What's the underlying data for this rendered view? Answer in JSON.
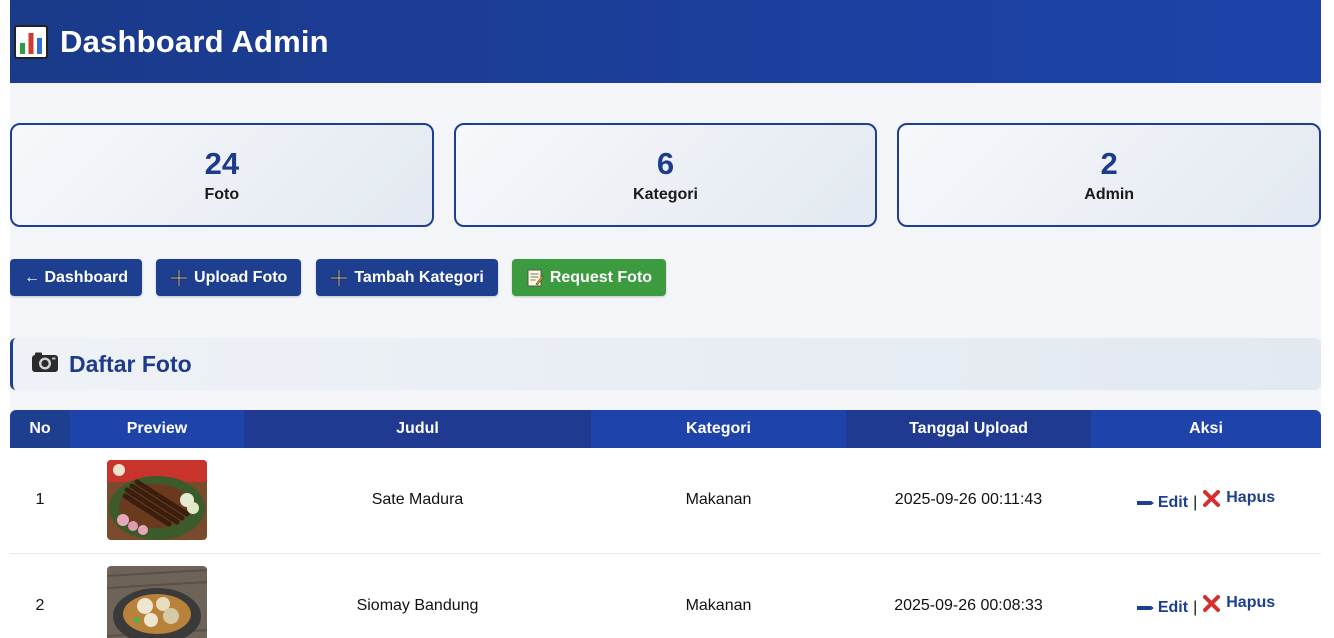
{
  "header": {
    "title": "Dashboard Admin",
    "icon": "bar-chart-icon"
  },
  "stats": [
    {
      "value": "24",
      "label": "Foto"
    },
    {
      "value": "6",
      "label": "Kategori"
    },
    {
      "value": "2",
      "label": "Admin"
    }
  ],
  "actions": {
    "dashboard": "← Dashboard",
    "upload": "Upload Foto",
    "tambah": "Tambah Kategori",
    "request": "Request Foto"
  },
  "section": {
    "title": "Daftar Foto"
  },
  "table": {
    "headers": [
      "No",
      "Preview",
      "Judul",
      "Kategori",
      "Tanggal Upload",
      "Aksi"
    ],
    "rows": [
      {
        "no": "1",
        "judul": "Sate Madura",
        "kategori": "Makanan",
        "tanggal": "2025-09-26 00:11:43",
        "edit": "Edit",
        "hapus": "Hapus"
      },
      {
        "no": "2",
        "judul": "Siomay Bandung",
        "kategori": "Makanan",
        "tanggal": "2025-09-26 00:08:33",
        "edit": "Edit",
        "hapus": "Hapus"
      }
    ]
  },
  "colors": {
    "primary": "#1e3f8f",
    "green": "#3c9a3f",
    "page": "#f3f5f9"
  }
}
